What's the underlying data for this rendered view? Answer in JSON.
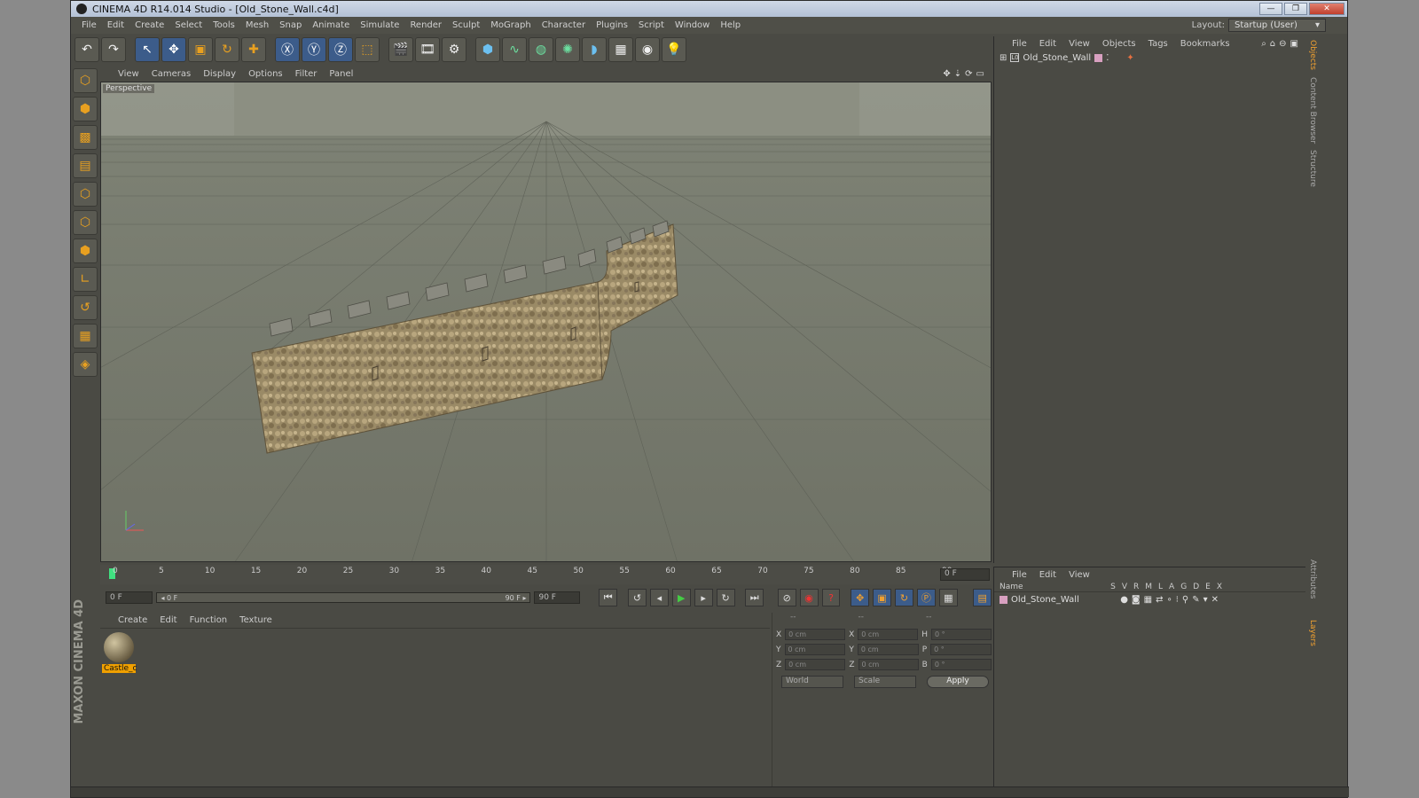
{
  "window": {
    "title": "CINEMA 4D R14.014 Studio - [Old_Stone_Wall.c4d]",
    "minimize": "—",
    "restore": "❐",
    "close": "✕"
  },
  "menu": [
    "File",
    "Edit",
    "Create",
    "Select",
    "Tools",
    "Mesh",
    "Snap",
    "Animate",
    "Simulate",
    "Render",
    "Sculpt",
    "MoGraph",
    "Character",
    "Plugins",
    "Script",
    "Window",
    "Help"
  ],
  "layout": {
    "label": "Layout:",
    "value": "Startup (User)"
  },
  "viewport": {
    "menu": [
      "View",
      "Cameras",
      "Display",
      "Options",
      "Filter",
      "Panel"
    ],
    "label": "Perspective"
  },
  "timeline": {
    "ticks": [
      "0",
      "5",
      "10",
      "15",
      "20",
      "25",
      "30",
      "35",
      "40",
      "45",
      "50",
      "55",
      "60",
      "65",
      "70",
      "75",
      "80",
      "85",
      "90"
    ],
    "current_frame": "0 F",
    "playhead_frame": 0,
    "last_frame": 90
  },
  "transport": {
    "start": "0 F",
    "slider_left": "◂ 0 F",
    "slider_right": "90 F ▸",
    "end": "90 F"
  },
  "material": {
    "menu": [
      "Create",
      "Edit",
      "Function",
      "Texture"
    ],
    "name": "Castle_c"
  },
  "coords": {
    "header": [
      "--",
      "--",
      "--"
    ],
    "rows": [
      {
        "a": "X",
        "av": "0 cm",
        "b": "X",
        "bv": "0 cm",
        "c": "H",
        "cv": "0 °"
      },
      {
        "a": "Y",
        "av": "0 cm",
        "b": "Y",
        "bv": "0 cm",
        "c": "P",
        "cv": "0 °"
      },
      {
        "a": "Z",
        "av": "0 cm",
        "b": "Z",
        "bv": "0 cm",
        "c": "B",
        "cv": "0 °"
      }
    ],
    "world": "World",
    "scale": "Scale",
    "apply": "Apply"
  },
  "objects": {
    "menu": [
      "File",
      "Edit",
      "View",
      "Objects",
      "Tags",
      "Bookmarks"
    ],
    "item": "Old_Stone_Wall"
  },
  "layers": {
    "menu": [
      "File",
      "Edit",
      "View"
    ],
    "name_col": "Name",
    "cols": [
      "S",
      "V",
      "R",
      "M",
      "L",
      "A",
      "G",
      "D",
      "E",
      "X"
    ],
    "item": "Old_Stone_Wall"
  },
  "sidetabs": [
    "Objects",
    "Content Browser",
    "Structure",
    "Attributes",
    "Layers"
  ],
  "brand": "MAXON CINEMA 4D"
}
